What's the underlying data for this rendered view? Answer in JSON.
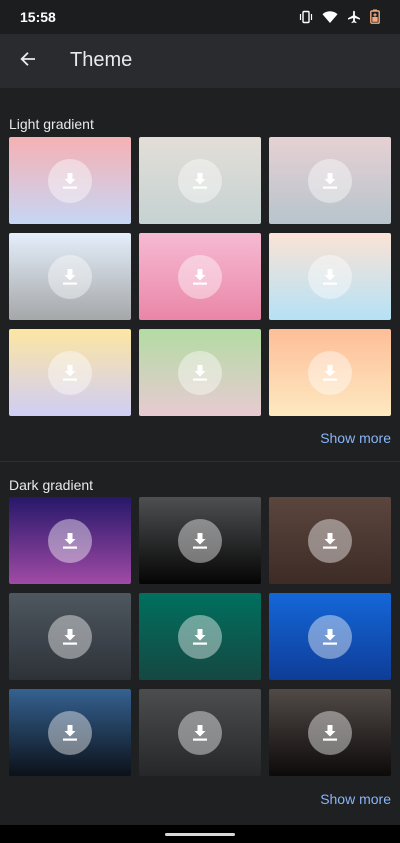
{
  "status_bar": {
    "time": "15:58",
    "icons": [
      "vibrate-icon",
      "wifi-icon",
      "airplane-icon",
      "battery-saver-icon"
    ]
  },
  "app_bar": {
    "back_icon": "arrow-back-icon",
    "title": "Theme"
  },
  "sections": [
    {
      "label": "Light gradient",
      "show_more": "Show more",
      "tiles": [
        {
          "name": "pink-blue",
          "colors": [
            "#f6b1b4",
            "#c6d6f4"
          ]
        },
        {
          "name": "beige-grey",
          "colors": [
            "#e3ded7",
            "#c5d2d2"
          ]
        },
        {
          "name": "mauve-slate",
          "colors": [
            "#e6d1d3",
            "#b7c4cc"
          ]
        },
        {
          "name": "sky-grey",
          "colors": [
            "#e4eefa",
            "#a5a7a9"
          ]
        },
        {
          "name": "pink",
          "colors": [
            "#f6bad2",
            "#ea86a8"
          ]
        },
        {
          "name": "peach-cyan",
          "colors": [
            "#fbe3d5",
            "#b5e1f6"
          ]
        },
        {
          "name": "yellow-lavender",
          "colors": [
            "#fde6a2",
            "#cfcdf5"
          ]
        },
        {
          "name": "green-pink",
          "colors": [
            "#b3dca3",
            "#e8cad2"
          ]
        },
        {
          "name": "orange-cream",
          "colors": [
            "#fdbe98",
            "#fde9c0"
          ]
        }
      ]
    },
    {
      "label": "Dark gradient",
      "show_more": "Show more",
      "tiles": [
        {
          "name": "indigo-magenta",
          "colors": [
            "#26186a",
            "#a04aa5"
          ]
        },
        {
          "name": "grey-black",
          "colors": [
            "#4e4f51",
            "#050505"
          ]
        },
        {
          "name": "brown",
          "colors": [
            "#5b463f",
            "#3d2b25"
          ]
        },
        {
          "name": "slate",
          "colors": [
            "#4e575f",
            "#2d3238"
          ]
        },
        {
          "name": "teal",
          "colors": [
            "#00705f",
            "#154842"
          ]
        },
        {
          "name": "blue",
          "colors": [
            "#1467d8",
            "#0e3d98"
          ]
        },
        {
          "name": "steel-blue",
          "colors": [
            "#356191",
            "#0c1119"
          ]
        },
        {
          "name": "charcoal",
          "colors": [
            "#4c4d4f",
            "#262729"
          ]
        },
        {
          "name": "taupe-black",
          "colors": [
            "#514a47",
            "#0d0a0a"
          ]
        }
      ]
    }
  ]
}
